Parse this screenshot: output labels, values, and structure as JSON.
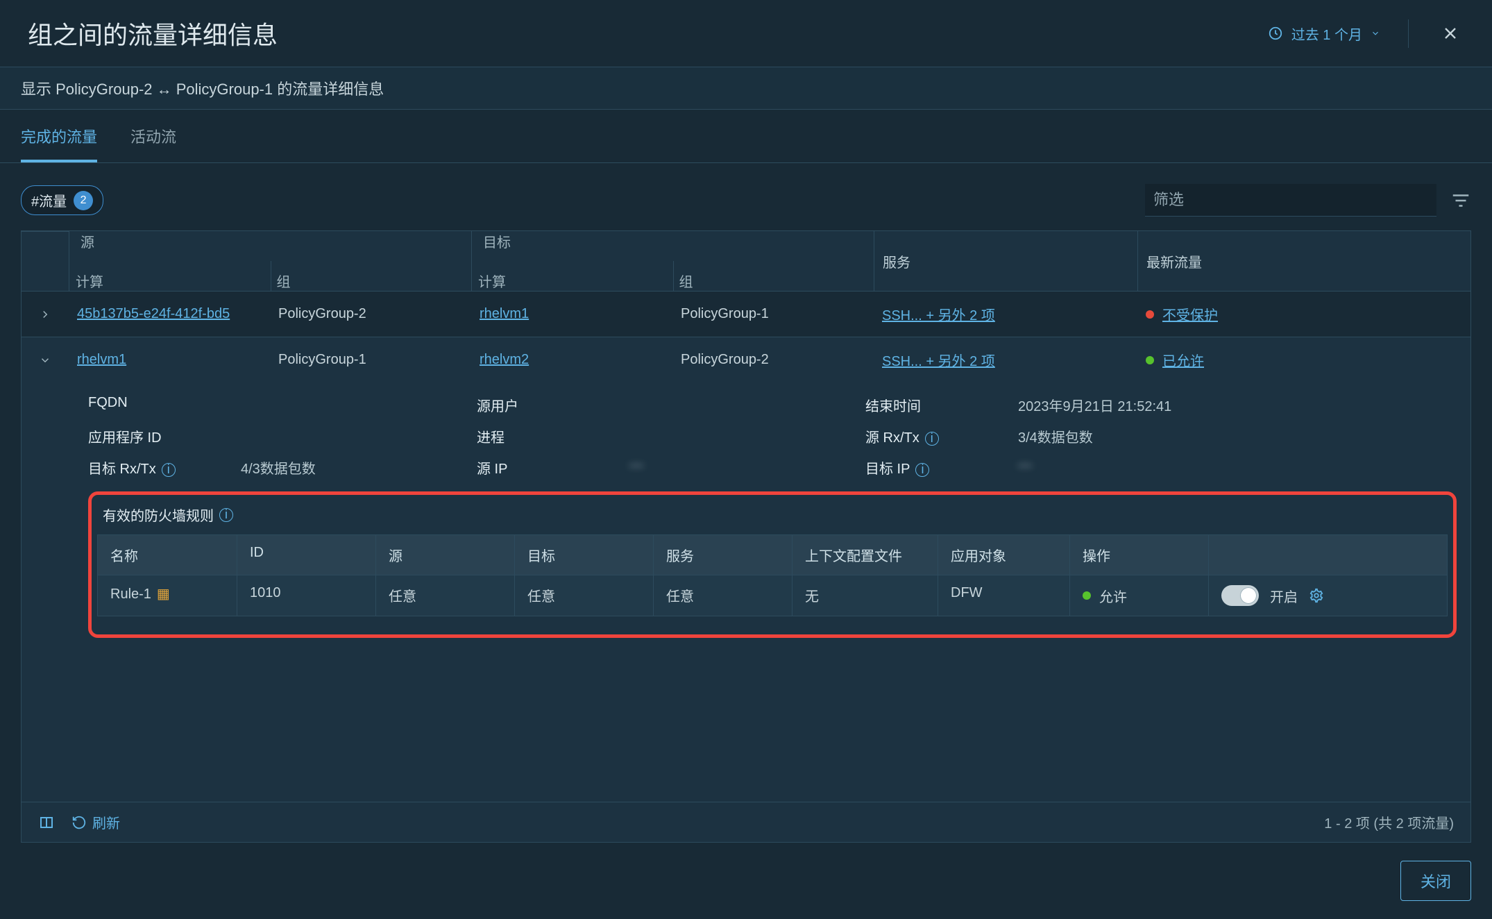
{
  "title": "组之间的流量详细信息",
  "time_filter": "过去 1 个月",
  "subtitle": "显示 PolicyGroup-2 ↔ PolicyGroup-1 的流量详细信息",
  "tabs": {
    "completed": "完成的流量",
    "active": "活动流"
  },
  "chip": {
    "label": "#流量",
    "count": "2"
  },
  "filter_placeholder": "筛选",
  "headers": {
    "source": "源",
    "target": "目标",
    "compute": "计算",
    "group": "组",
    "service": "服务",
    "latest": "最新流量"
  },
  "rows": [
    {
      "source_compute": "45b137b5-e24f-412f-bd5",
      "source_group": "PolicyGroup-2",
      "target_compute": "rhelvm1",
      "target_group": "PolicyGroup-1",
      "service": "SSH... + 另外 2 项",
      "status_text": "不受保护",
      "status_type": "red"
    },
    {
      "source_compute": "rhelvm1",
      "source_group": "PolicyGroup-1",
      "target_compute": "rhelvm2",
      "target_group": "PolicyGroup-2",
      "service": "SSH... + 另外 2 项",
      "status_text": "已允许",
      "status_type": "green"
    }
  ],
  "details": {
    "labels": {
      "fqdn": "FQDN",
      "src_user": "源用户",
      "end_time": "结束时间",
      "app_id": "应用程序 ID",
      "process": "进程",
      "src_rxtx": "源 Rx/Tx",
      "dst_rxtx": "目标 Rx/Tx",
      "src_ip": "源 IP",
      "dst_ip": "目标 IP"
    },
    "values": {
      "end_time": "2023年9月21日 21:52:41",
      "src_rxtx": "3/4数据包数",
      "dst_rxtx": "4/3数据包数",
      "src_ip": "—",
      "dst_ip": "—"
    },
    "rules_title": "有效的防火墙规则",
    "rule_headers": {
      "name": "名称",
      "id": "ID",
      "source": "源",
      "target": "目标",
      "service": "服务",
      "context": "上下文配置文件",
      "applied_to": "应用对象",
      "action": "操作"
    },
    "rule": {
      "name": "Rule-1",
      "id": "1010",
      "source": "任意",
      "target": "任意",
      "service": "任意",
      "context": "无",
      "applied_to": "DFW",
      "action": "允许",
      "toggle_label": "开启"
    }
  },
  "footer": {
    "refresh": "刷新",
    "range": "1 - 2 项 (共 2 项流量)"
  },
  "close_button": "关闭"
}
